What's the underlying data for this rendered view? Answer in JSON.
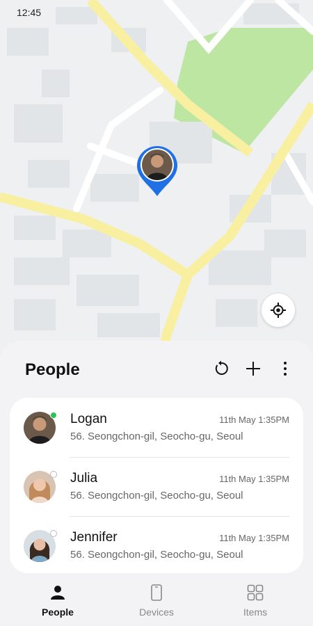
{
  "status_bar": {
    "time": "12:45"
  },
  "sheet": {
    "title": "People",
    "actions": {
      "refresh": "refresh-icon",
      "add": "plus-icon",
      "more": "more-vertical-icon"
    }
  },
  "people": [
    {
      "name": "Logan",
      "time": "11th May 1:35PM",
      "address": "56. Seongchon-gil, Seocho-gu, Seoul",
      "status_color": "#2ec453",
      "status": "online"
    },
    {
      "name": "Julia",
      "time": "11th May 1:35PM",
      "address": "56. Seongchon-gil, Seocho-gu, Seoul",
      "status_color": "#ffffff",
      "status": "offline"
    },
    {
      "name": "Jennifer",
      "time": "11th May 1:35PM",
      "address": "56. Seongchon-gil, Seocho-gu, Seoul",
      "status_color": "#ffffff",
      "status": "offline"
    }
  ],
  "bottom_nav": [
    {
      "label": "People",
      "icon": "person-icon",
      "active": true
    },
    {
      "label": "Devices",
      "icon": "phone-icon",
      "active": false
    },
    {
      "label": "Items",
      "icon": "grid-icon",
      "active": false
    }
  ],
  "colors": {
    "accent": "#1f6fe5",
    "map_road_major": "#f7ef9c",
    "map_park": "#b8e39c",
    "map_bg": "#eef0f2"
  }
}
